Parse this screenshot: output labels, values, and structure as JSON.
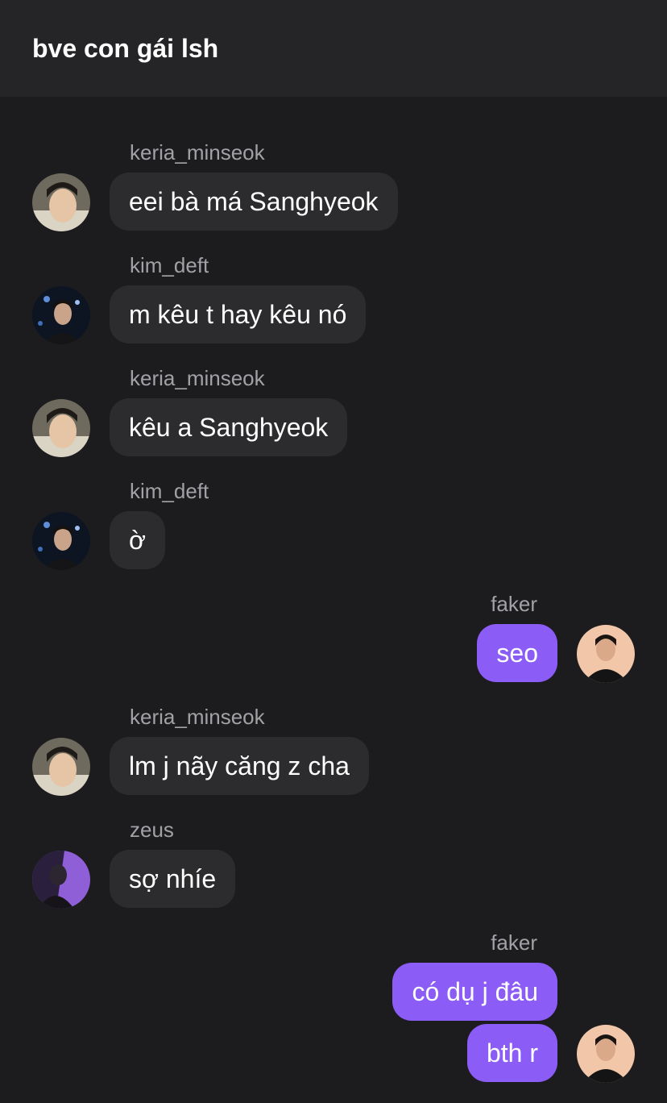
{
  "header": {
    "title": "bve con gái lsh"
  },
  "messages": [
    {
      "sender": "keria_minseok",
      "text": "eei bà má Sanghyeok"
    },
    {
      "sender": "kim_deft",
      "text": "m kêu t hay kêu nó"
    },
    {
      "sender": "keria_minseok",
      "text": "kêu a Sanghyeok"
    },
    {
      "sender": "kim_deft",
      "text": "ờ"
    },
    {
      "sender": "faker",
      "text": "seo"
    },
    {
      "sender": "keria_minseok",
      "text": "lm j nãy căng z cha"
    },
    {
      "sender": "zeus",
      "text": "sợ nhíe"
    },
    {
      "sender": "faker",
      "text": "có dụ j đâu"
    },
    {
      "sender": "faker",
      "text": "bth r"
    }
  ],
  "colors": {
    "background": "#1c1c1e",
    "header": "#252527",
    "incoming_bubble": "#2c2c2e",
    "outgoing_bubble": "#8b5cf6",
    "sender_name": "#a1a1a6"
  }
}
